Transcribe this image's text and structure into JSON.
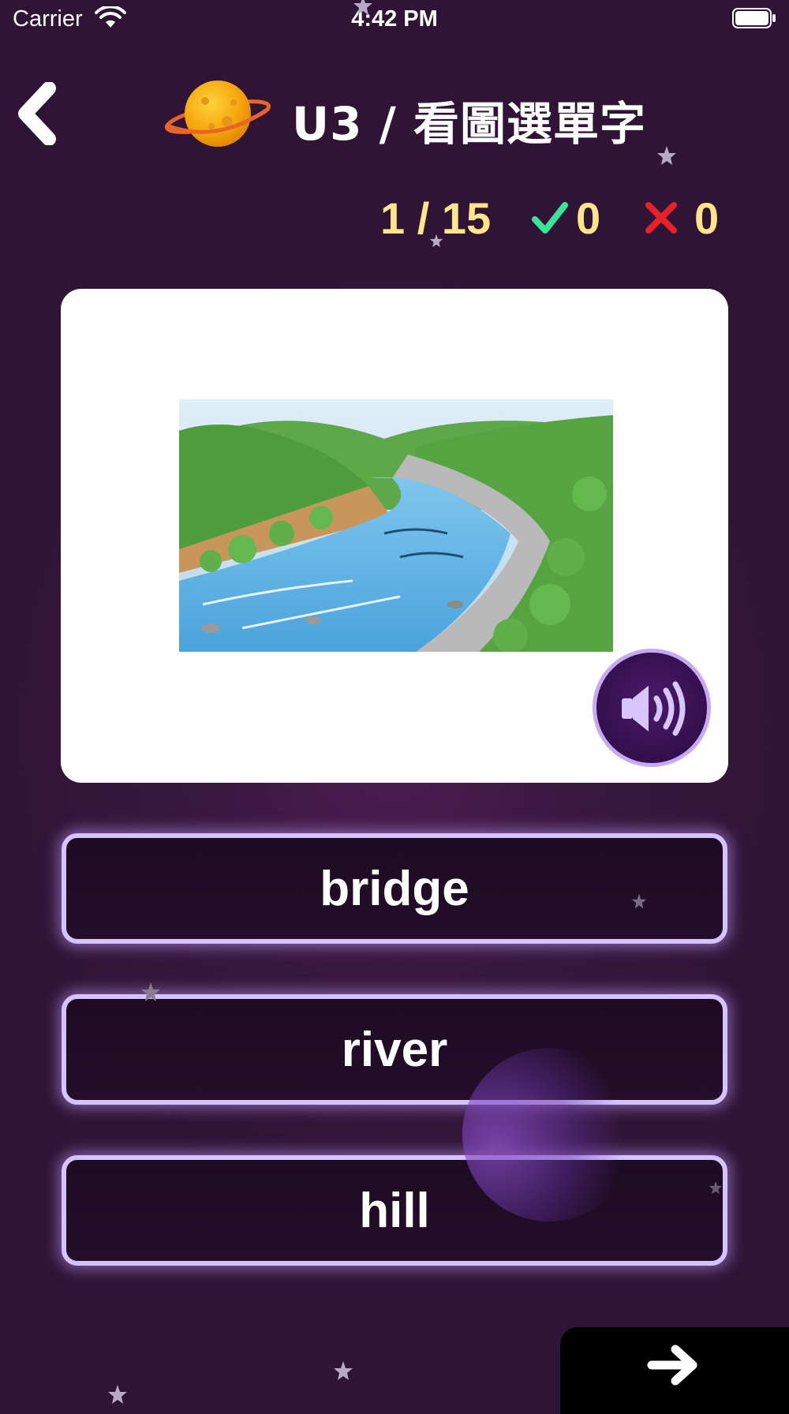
{
  "status_bar": {
    "carrier": "Carrier",
    "time": "4:42 PM"
  },
  "header": {
    "title": "U3 / 看圖選單字",
    "back_icon": "chevron-left-icon",
    "planet_icon": "planet-icon"
  },
  "score": {
    "progress": "1 / 15",
    "correct": "0",
    "wrong": "0"
  },
  "question": {
    "image_icon": "river-illustration",
    "sound_icon": "speaker-icon"
  },
  "answers": [
    {
      "label": "bridge"
    },
    {
      "label": "river"
    },
    {
      "label": "hill"
    }
  ],
  "colors": {
    "background": "#3a1840",
    "score_text": "#fde58a",
    "correct": "#39e39a",
    "wrong": "#e8202a",
    "answer_border": "#d5c2ff",
    "sound_button": "#2a0a40"
  },
  "next_icon": "arrow-right-icon"
}
